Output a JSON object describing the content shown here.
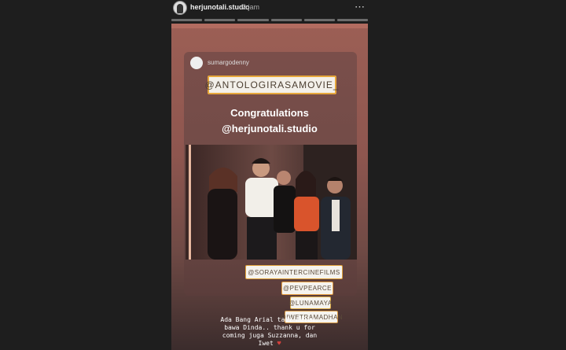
{
  "header": {
    "username": "herjunotali.studio",
    "time": "2 jam",
    "more_icon": "⋯"
  },
  "story": {
    "shared_post": {
      "username": "sumargodenny"
    },
    "movie_tag": "@ANTOLOGIRASAMOVIE_",
    "congrats_line1": "Congratulations",
    "congrats_line2": "@herjunotali.studio",
    "mentions": [
      "@SORAYAINTERCINEFILMS",
      "@PEVPEARCE",
      "@LUNAMAYA",
      "@IWETRAMADHAN"
    ],
    "caption_lines": [
      "Ada Bang Arial tadi malem,",
      "bawa Dinda.. thank u for",
      "coming juga Suzzanna, dan",
      "Iwet"
    ],
    "caption_heart": "♥"
  }
}
